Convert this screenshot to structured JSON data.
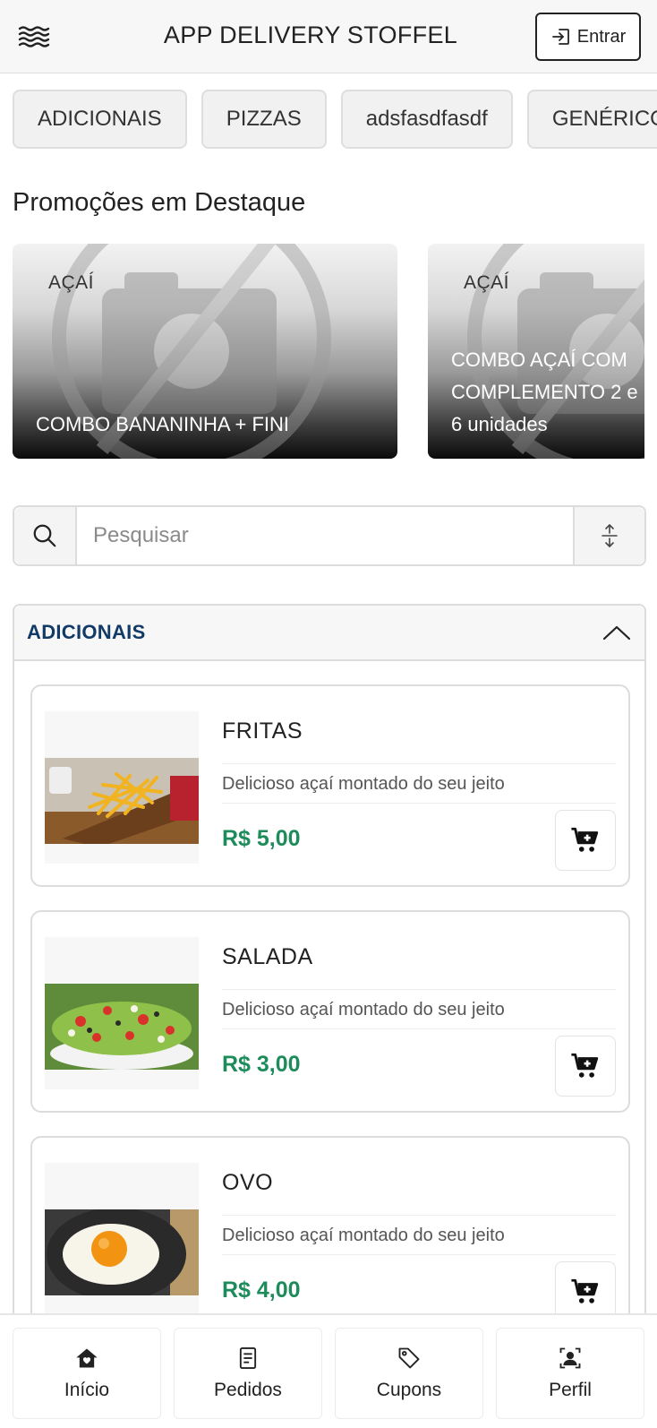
{
  "header": {
    "title": "APP DELIVERY STOFFEL",
    "menu_icon": "menu-icon",
    "login_label": "Entrar",
    "login_icon": "sign-in-icon"
  },
  "categories": [
    "ADICIONAIS",
    "PIZZAS",
    "adsfasdfasdf",
    "GENÉRICO"
  ],
  "promotions": {
    "title": "Promoções em Destaque",
    "cards": [
      {
        "badge": "AÇAÍ",
        "caption_lines": [
          "COMBO BANANINHA + FINI"
        ]
      },
      {
        "badge": "AÇAÍ",
        "caption_lines": [
          "COMBO AÇAÍ COM",
          "COMPLEMENTO 2 e",
          "6 unidades"
        ]
      }
    ]
  },
  "search": {
    "placeholder": "Pesquisar",
    "search_icon": "search-icon",
    "sort_icon": "sort-icon"
  },
  "section": {
    "title": "ADICIONAIS",
    "toggle_icon": "chevron-up-icon",
    "items": [
      {
        "name": "FRITAS",
        "description": "Delicioso açaí montado do seu jeito",
        "price": "R$ 5,00"
      },
      {
        "name": "SALADA",
        "description": "Delicioso açaí montado do seu jeito",
        "price": "R$ 3,00"
      },
      {
        "name": "OVO",
        "description": "Delicioso açaí montado do seu jeito",
        "price": "R$ 4,00"
      }
    ]
  },
  "bottom_nav": [
    {
      "label": "Início",
      "icon": "home-icon"
    },
    {
      "label": "Pedidos",
      "icon": "receipt-icon"
    },
    {
      "label": "Cupons",
      "icon": "tag-icon"
    },
    {
      "label": "Perfil",
      "icon": "profile-icon"
    }
  ],
  "colors": {
    "accent_title": "#123a66",
    "price": "#1e8c5a"
  }
}
